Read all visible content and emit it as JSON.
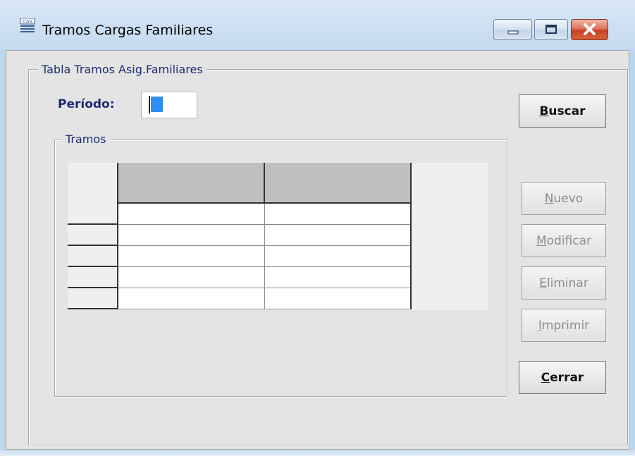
{
  "window": {
    "title": "Tramos Cargas Familiares",
    "icon": "cas-app-icon",
    "controls": [
      "minimize-icon",
      "maximize-icon",
      "close-icon"
    ]
  },
  "group_main": {
    "legend": "Tabla Tramos Asig.Familiares"
  },
  "periodo": {
    "label": "Período:",
    "value": ""
  },
  "group_tramos": {
    "legend": "Tramos"
  },
  "grid": {
    "columns": [
      "",
      ""
    ],
    "rows": [
      [
        "",
        ""
      ],
      [
        "",
        ""
      ],
      [
        "",
        ""
      ],
      [
        "",
        ""
      ],
      [
        "",
        ""
      ]
    ]
  },
  "buttons": {
    "buscar": {
      "accel": "B",
      "rest": "uscar",
      "enabled": true
    },
    "nuevo": {
      "accel": "N",
      "rest": "uevo",
      "enabled": false
    },
    "modificar": {
      "accel": "M",
      "rest": "odificar",
      "enabled": false
    },
    "eliminar": {
      "accel": "E",
      "rest": "liminar",
      "enabled": false
    },
    "imprimir": {
      "accel": "I",
      "rest": "mprimir",
      "enabled": false
    },
    "cerrar": {
      "accel": "C",
      "rest": "errar",
      "enabled": true
    }
  },
  "colors": {
    "label_blue": "#1a2e73",
    "close_red": "#c84225",
    "field_selection": "#2d8ff4"
  }
}
